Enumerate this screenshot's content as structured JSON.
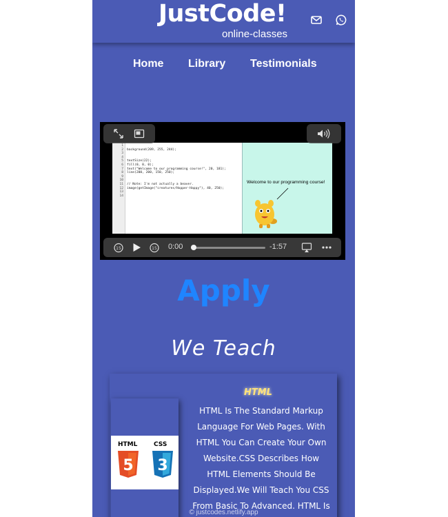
{
  "header": {
    "brand": "JustCode!",
    "tagline": "online-classes",
    "icons": [
      "mail-icon",
      "whatsapp-icon"
    ]
  },
  "nav": {
    "items": [
      {
        "label": "Home"
      },
      {
        "label": "Library"
      },
      {
        "label": "Testimonials"
      }
    ]
  },
  "video": {
    "code_line_numbers": "1\n2\n3\n4\n5\n6\n7\n8\n9\n10\n11\n12\n13\n14",
    "code": "\nbackground(209, 255, 244);\n\n\ntextSize(22);\nfill(0, 0, 0);\ntext(\"Welcome to our programming course!\", 20, 181);\nline(200, 200, 150, 250);\n\n\n// Note: I'm not actually a beaver.\nimage(getImage(\"creatures/Hopper-Happy\"), 40, 250);\n\n",
    "preview_text": "Welcome to our programming course!",
    "current_time": "0:00",
    "remaining_time": "-1:57",
    "progress": 0.0,
    "controls": [
      "expand-icon",
      "picture-in-picture-icon",
      "volume-icon",
      "skip-back-15-icon",
      "play-icon",
      "skip-forward-15-icon",
      "airplay-icon",
      "more-icon"
    ]
  },
  "apply": {
    "label": "Apply",
    "color": "#1f85ff"
  },
  "we_teach": {
    "heading": "We Teach"
  },
  "course_card": {
    "logo_html": "HTML",
    "logo_css": "CSS",
    "title": "HTML",
    "description": "HTML Is The Standard Markup Language For Web Pages. With HTML You Can Create Your Own Website.CSS Describes How HTML Elements Should Be Displayed.We Will Teach You CSS From Basic To Advanced. HTML Is Easy To Learn"
  },
  "footer": {
    "url": "© justcodes.netlify.app"
  },
  "colors": {
    "background": "#4b5bb5",
    "accent": "#1f85ff",
    "title_glow": "#ffe27a"
  }
}
